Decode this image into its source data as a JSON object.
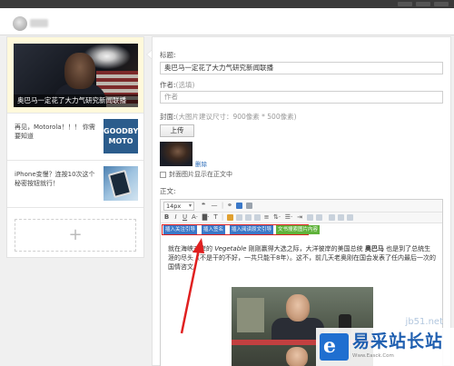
{
  "colors": {
    "accent_blue": "#3a78c8",
    "accent_green": "#5fb23a",
    "highlight_red": "#e02020",
    "selected_bg": "#fff9db",
    "watermark_blue": "#1f5fb0"
  },
  "left_panel": {
    "cover_caption": "奥巴马一定花了大力气研究新闻联播",
    "items": [
      {
        "title": "再见，Motorola！！！ 你需要知道",
        "thumb_text": "GOODBYE MOTO"
      },
      {
        "title": "iPhone变慢？连按10次这个秘密按钮就行！",
        "thumb_icon": "phone-image"
      }
    ],
    "add_icon": "+"
  },
  "form": {
    "title_label": "标题:",
    "title_value": "奥巴马一定花了大力气研究新闻联播",
    "author_label": "作者:",
    "author_hint": "(选填)",
    "author_placeholder": "作者",
    "cover_label": "封面:",
    "cover_hint": "(大图片建议尺寸：900像素 * 500像素)",
    "upload_label": "上传",
    "delete_label": "删除",
    "show_cover_label": "封面图片显示在正文中",
    "body_label": "正文:"
  },
  "toolbar": {
    "font_size": "14px",
    "row1_icons": [
      "quote-icon",
      "hr-icon",
      "link-icon",
      "image-icon",
      "video-icon"
    ],
    "row2_icons": [
      "bold-icon",
      "italic-icon",
      "underline-icon",
      "font-color-icon",
      "align-left-icon",
      "align-center-icon",
      "align-right-icon",
      "list-icon",
      "indent-icon"
    ],
    "insert_buttons": [
      "插入关注引导",
      "插入签名",
      "插入阅读原文引导",
      "文书搜索图片内容"
    ]
  },
  "content": {
    "line1_a": "就在海峡对岸的 ",
    "line1_italic": "Vegetable",
    "line1_b": " 刚刚赢得大选之际，大洋彼岸的美国总统 ",
    "line1_bold": "奥巴马",
    "line1_c": " 也是到了总统生涯的尽头（不是干的不好，一共只能干8年）。这不，前几天老奥刚在国会发表了任内最后一次的国情咨文。"
  },
  "watermark": {
    "url": "jb51.net",
    "name": "易采站长站",
    "sub": "Www.Easck.Com"
  }
}
